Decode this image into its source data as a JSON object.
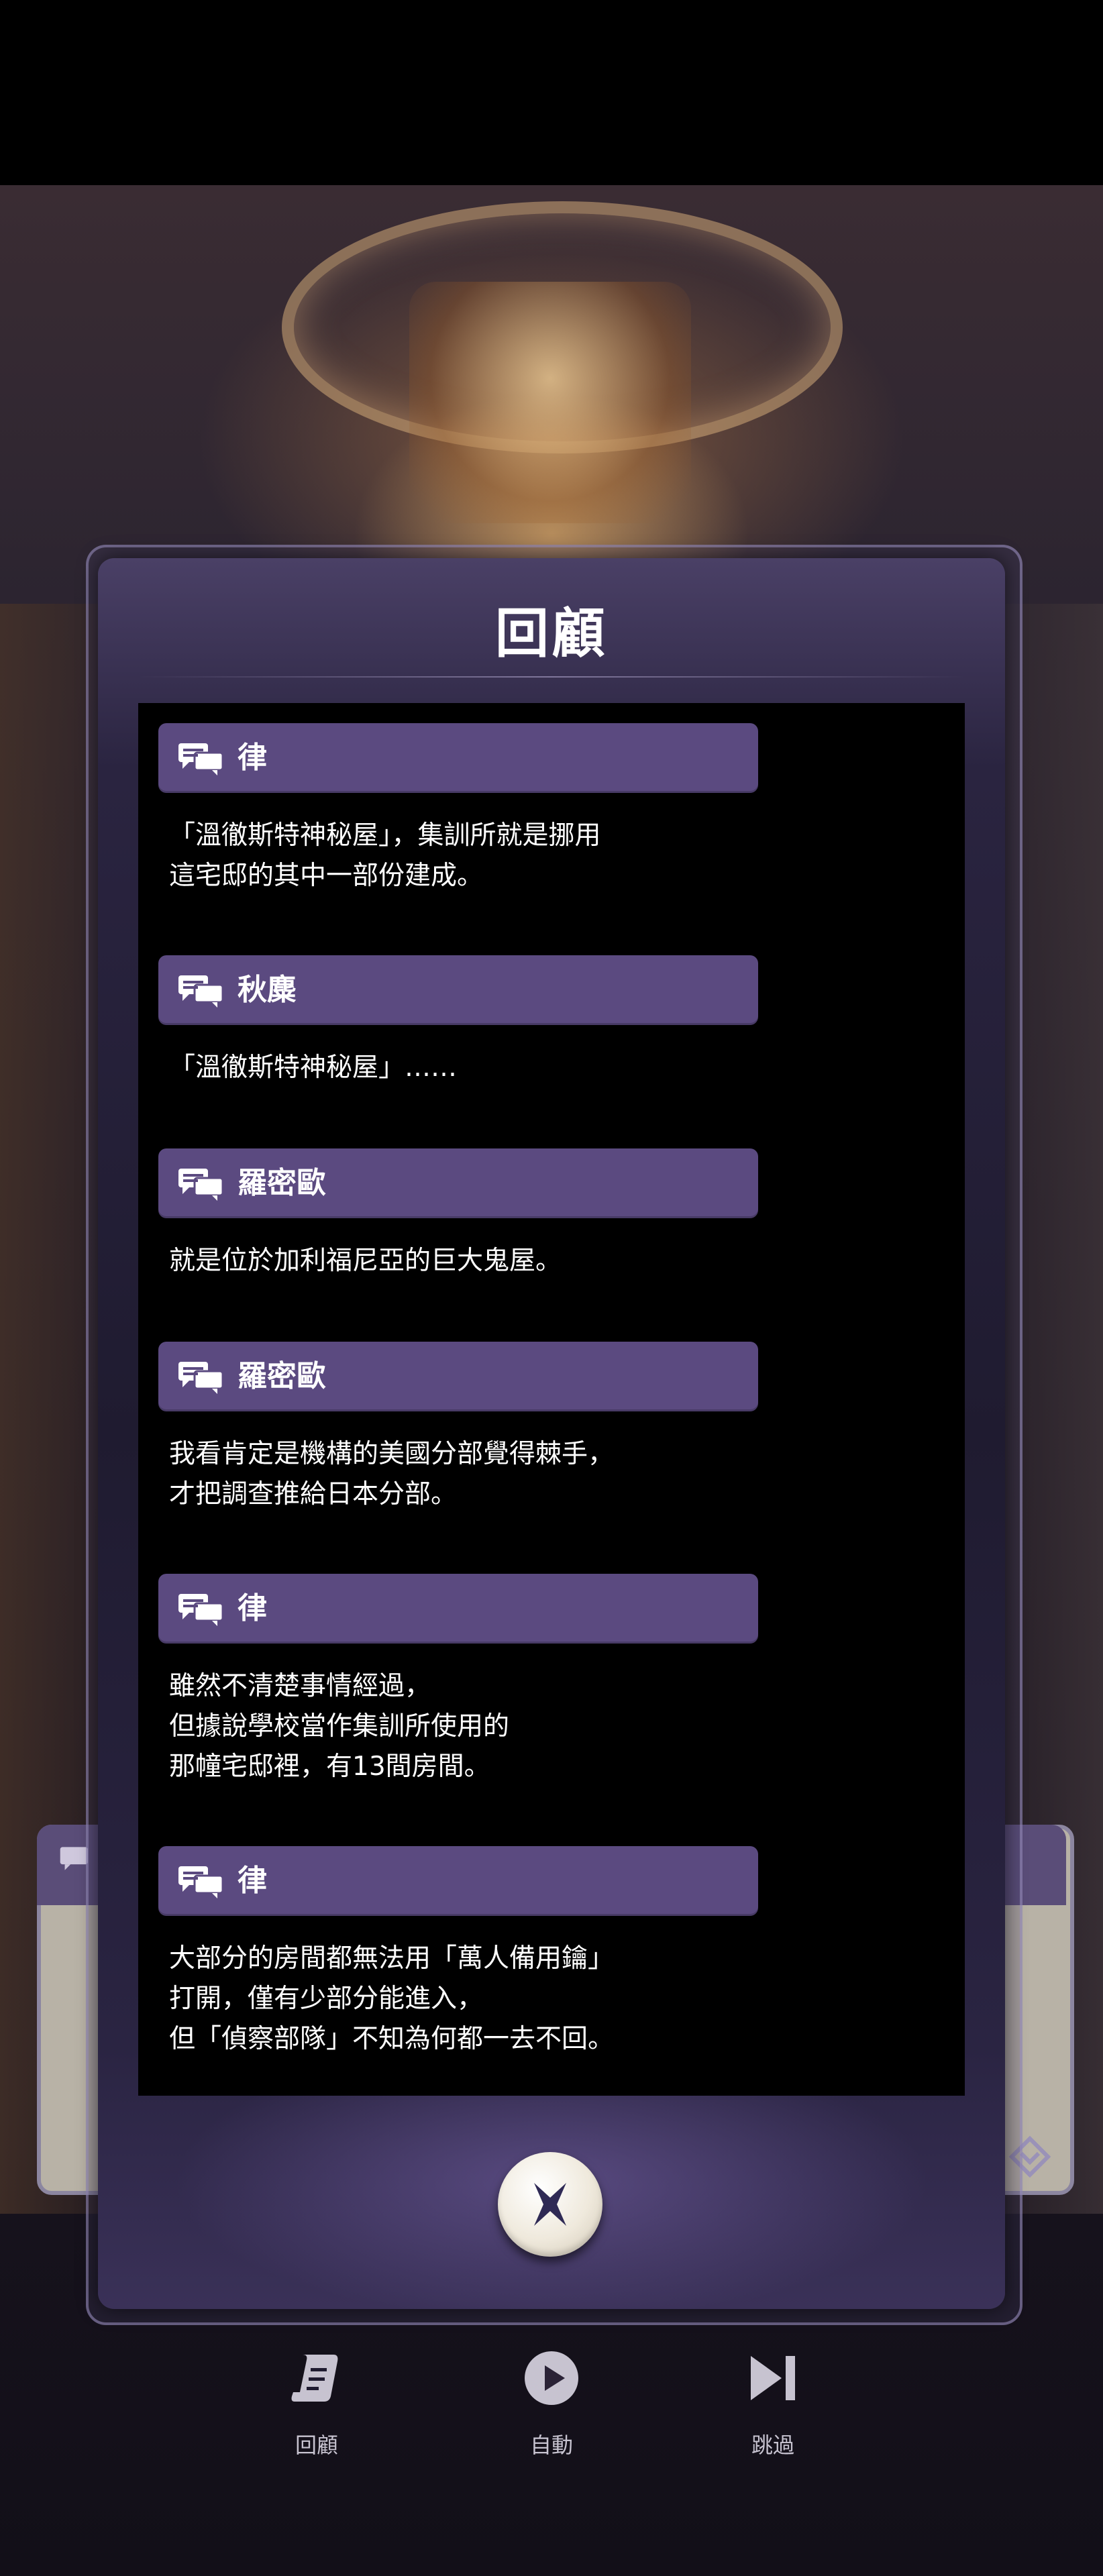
{
  "backlog": {
    "title": "回顧",
    "entries": [
      {
        "speaker": "律",
        "lines": [
          "「溫徹斯特神秘屋」，集訓所就是挪用",
          "這宅邸的其中一部份建成。"
        ]
      },
      {
        "speaker": "秋麋",
        "lines": [
          "「溫徹斯特神秘屋」……"
        ]
      },
      {
        "speaker": "羅密歐",
        "lines": [
          "就是位於加利福尼亞的巨大鬼屋。"
        ]
      },
      {
        "speaker": "羅密歐",
        "lines": [
          "我看肯定是機構的美國分部覺得棘手，",
          "才把調查推給日本分部。"
        ]
      },
      {
        "speaker": "律",
        "lines": [
          "雖然不清楚事情經過，",
          "但據說學校當作集訓所使用的",
          "那幢宅邸裡，有13間房間。"
        ]
      },
      {
        "speaker": "律",
        "lines": [
          "大部分的房間都無法用「萬人備用鑰」",
          "打開，僅有少部分能進入，",
          "但「偵察部隊」不知為何都一去不回。"
        ]
      }
    ]
  },
  "controls": {
    "backlog_label": "回顧",
    "auto_label": "自動",
    "skip_label": "跳過"
  },
  "icons": {
    "speaker": "chat-bubbles-icon",
    "close": "close-icon",
    "backlog": "scroll-icon",
    "auto": "play-icon",
    "skip": "skip-icon"
  },
  "colors": {
    "speaker_bar": "#5b4a80",
    "panel": "#2a2440",
    "log_bg": "#000000",
    "text": "#ffffff",
    "control_text": "#c7c3d0"
  }
}
